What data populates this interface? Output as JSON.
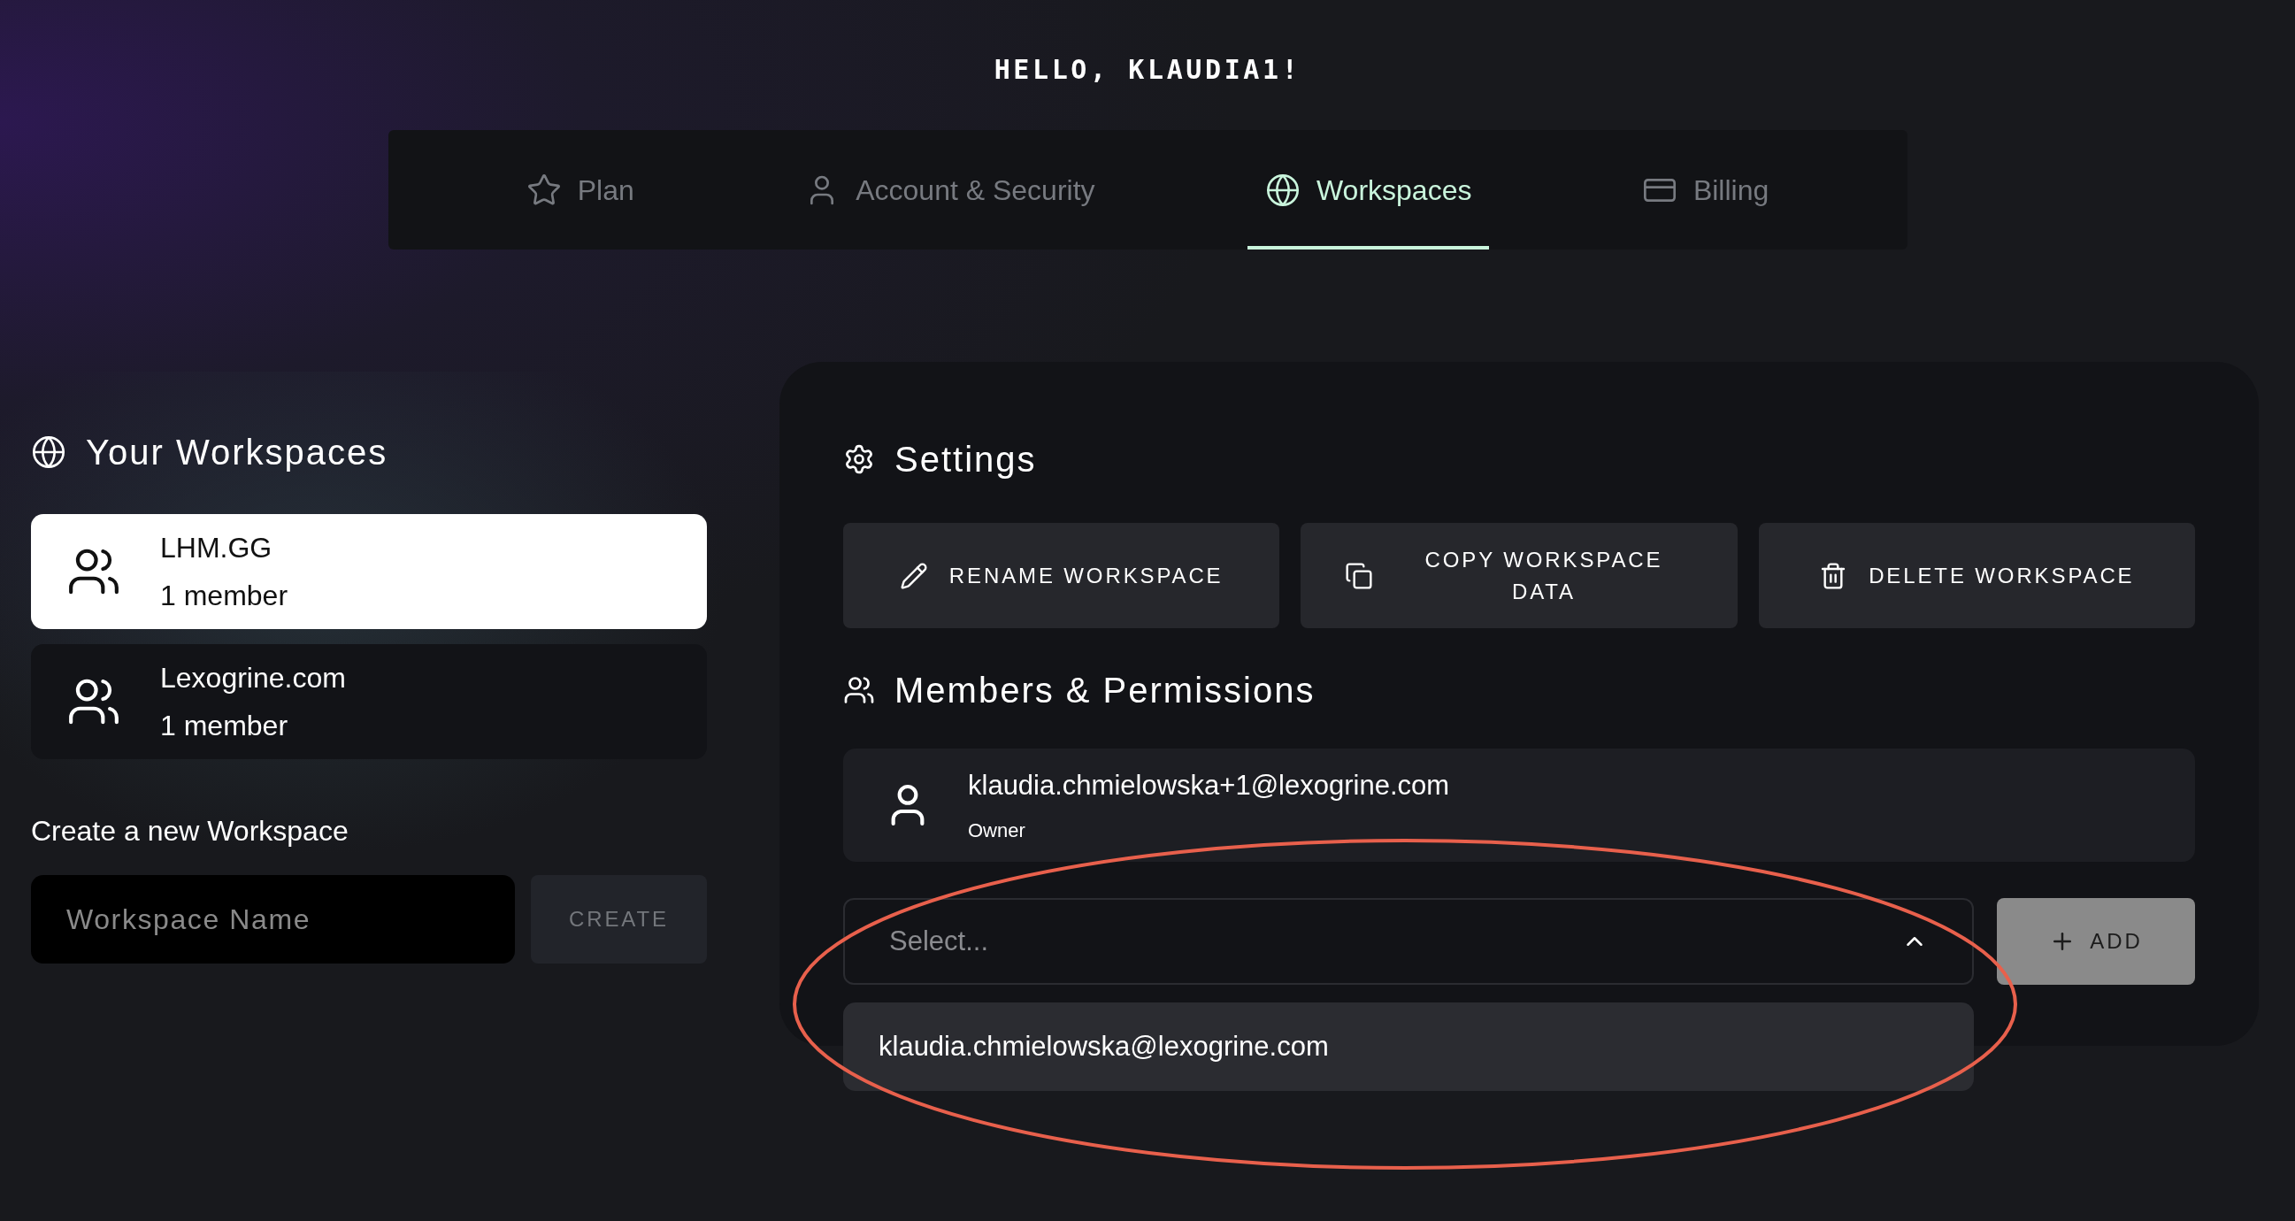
{
  "greeting": "HELLO, KLAUDIA1!",
  "tabs": [
    {
      "label": "Plan",
      "kind": "plan",
      "selected": false
    },
    {
      "label": "Account & Security",
      "kind": "account",
      "selected": false
    },
    {
      "label": "Workspaces",
      "kind": "workspaces",
      "selected": true
    },
    {
      "label": "Billing",
      "kind": "billing",
      "selected": false
    }
  ],
  "workspaces": {
    "title": "Your Workspaces",
    "items": [
      {
        "name": "LHM.GG",
        "members": "1 member",
        "selected": true
      },
      {
        "name": "Lexogrine.com",
        "members": "1 member",
        "selected": false
      }
    ],
    "create_label": "Create a new Workspace",
    "name_field": {
      "placeholder": "Workspace Name"
    },
    "create_button": {
      "label": "CREATE",
      "disabled": true
    }
  },
  "settings": {
    "title": "Settings",
    "buttons": [
      {
        "label": "RENAME WORKSPACE",
        "kind": "rename"
      },
      {
        "label": "COPY WORKSPACE DATA",
        "kind": "copy"
      },
      {
        "label": "DELETE WORKSPACE",
        "kind": "delete"
      }
    ]
  },
  "members": {
    "title": "Members & Permissions",
    "list": [
      {
        "email": "klaudia.chmielowska+1@lexogrine.com",
        "role": "Owner"
      }
    ],
    "select": {
      "placeholder": "Select...",
      "expanded": true,
      "options": [
        "klaudia.chmielowska@lexogrine.com"
      ]
    },
    "add_button": {
      "label": "ADD",
      "disabled": true
    }
  }
}
